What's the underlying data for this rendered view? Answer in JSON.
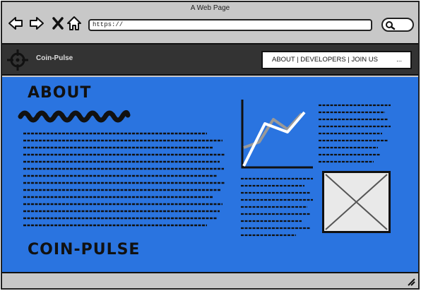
{
  "window": {
    "title": "A Web Page"
  },
  "browser": {
    "url": "https://",
    "icons": [
      "back-arrow-icon",
      "forward-arrow-icon",
      "close-x-icon",
      "home-icon",
      "search-icon"
    ]
  },
  "site": {
    "brand": "Coin-Pulse",
    "menu": "ABOUT | DEVELOPERS | JOIN US",
    "menu_more": "...",
    "logo_icon": "crosshair-icon"
  },
  "content": {
    "about_heading": "ABOUT",
    "footer_heading": "COIN-PULSE",
    "background_color": "#2a74e0",
    "chart_lines": [
      "white",
      "gray"
    ]
  }
}
